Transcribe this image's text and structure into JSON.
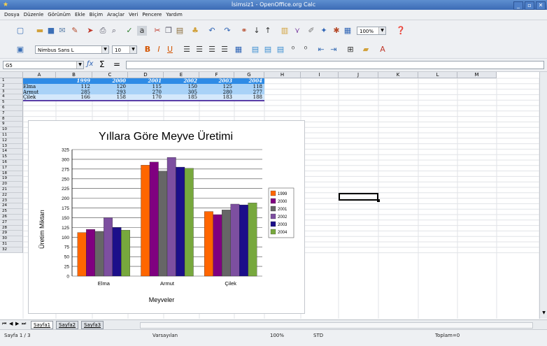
{
  "window": {
    "title": "İsimsiz1 - OpenOffice.org Calc",
    "controls": [
      "_",
      "▫",
      "✕"
    ]
  },
  "menu": [
    "Dosya",
    "Düzenle",
    "Görünüm",
    "Ekle",
    "Biçim",
    "Araçlar",
    "Veri",
    "Pencere",
    "Yardım"
  ],
  "toolbar": {
    "font_name": "Nimbus Sans L",
    "font_size": "10",
    "zoom": "100%",
    "bold": "B",
    "italic": "I",
    "underline": "U"
  },
  "formula_bar": {
    "cell_ref": "G5",
    "fx": "ƒx",
    "sum": "Σ",
    "equals": "="
  },
  "grid": {
    "columns": [
      "A",
      "B",
      "C",
      "D",
      "E",
      "F",
      "G",
      "H",
      "I",
      "J",
      "K",
      "L",
      "M"
    ],
    "rows": [
      "1",
      "2",
      "3",
      "4",
      "5",
      "6",
      "7",
      "8",
      "9",
      "10",
      "11",
      "12",
      "13",
      "14",
      "15",
      "16",
      "17",
      "18",
      "19",
      "20",
      "21",
      "22",
      "23",
      "24",
      "25",
      "26",
      "27",
      "28",
      "29",
      "30",
      "31",
      "32"
    ],
    "table": {
      "years": [
        "1999",
        "2000",
        "2001",
        "2002",
        "2003",
        "2004"
      ],
      "rows": [
        {
          "label": "Elma",
          "values": [
            "112",
            "120",
            "115",
            "150",
            "125",
            "118"
          ]
        },
        {
          "label": "Armut",
          "values": [
            "285",
            "293",
            "270",
            "305",
            "280",
            "277"
          ]
        },
        {
          "label": "Çilek",
          "values": [
            "166",
            "158",
            "170",
            "185",
            "183",
            "188"
          ]
        }
      ]
    }
  },
  "chart_data": {
    "type": "bar",
    "title": "Yıllara Göre Meyve Üretimi",
    "xlabel": "Meyveler",
    "ylabel": "Üretim Miktarı",
    "categories": [
      "Elma",
      "Armut",
      "Çilek"
    ],
    "ylim": [
      0,
      325
    ],
    "yticks": [
      "0",
      "25",
      "50",
      "75",
      "100",
      "125",
      "150",
      "175",
      "200",
      "225",
      "250",
      "275",
      "300",
      "325"
    ],
    "grid": true,
    "legend_position": "right",
    "series": [
      {
        "name": "1999",
        "color": "#ff6600",
        "values": [
          112,
          285,
          166
        ]
      },
      {
        "name": "2000",
        "color": "#800080",
        "values": [
          120,
          293,
          158
        ]
      },
      {
        "name": "2001",
        "color": "#666666",
        "values": [
          115,
          270,
          170
        ]
      },
      {
        "name": "2002",
        "color": "#7d4fa0",
        "values": [
          150,
          305,
          185
        ]
      },
      {
        "name": "2003",
        "color": "#1c0f8a",
        "values": [
          125,
          280,
          183
        ]
      },
      {
        "name": "2004",
        "color": "#77a83d",
        "values": [
          118,
          277,
          188
        ]
      }
    ]
  },
  "sheet_tabs": [
    "Sayfa1",
    "Sayfa2",
    "Sayfa3"
  ],
  "status": {
    "page": "Sayfa 1 / 3",
    "style": "Varsayılan",
    "zoom": "100%",
    "mode": "STD",
    "sum": "Toplam=0"
  }
}
